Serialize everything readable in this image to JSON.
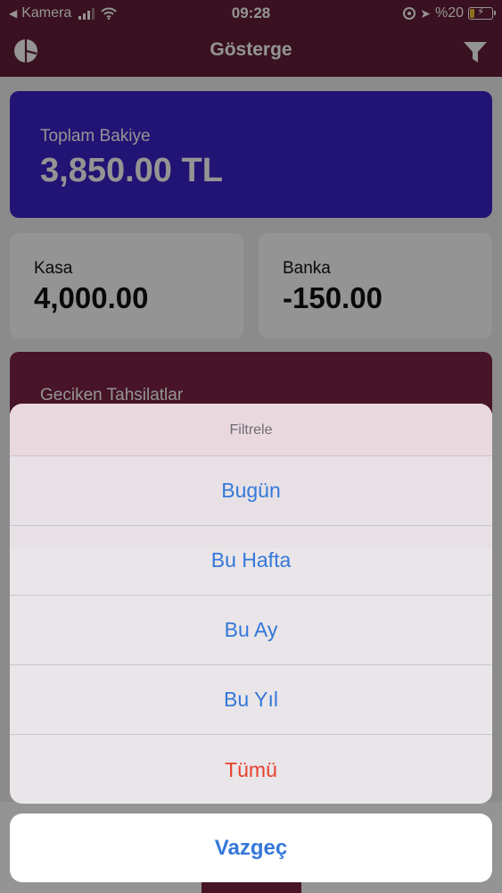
{
  "status_bar": {
    "back_glyph": "◀",
    "carrier": "Kamera",
    "time": "09:28",
    "battery": "%20",
    "battery_level": 0.2,
    "icons": [
      "signal-icon",
      "wifi-icon",
      "orientation-lock-icon",
      "location-icon",
      "battery-icon"
    ]
  },
  "nav": {
    "title": "Gösterge",
    "left_icon": "pie-chart-icon",
    "right_icon": "filter-icon"
  },
  "dashboard": {
    "total": {
      "label": "Toplam Bakiye",
      "value": "3,850.00 TL"
    },
    "kasa": {
      "label": "Kasa",
      "value": "4,000.00"
    },
    "banka": {
      "label": "Banka",
      "value": "-150.00"
    },
    "late": {
      "label": "Geciken Tahsilatlar"
    }
  },
  "action_sheet": {
    "title": "Filtrele",
    "options": [
      {
        "label": "Bugün"
      },
      {
        "label": "Bu Hafta"
      },
      {
        "label": "Bu Ay"
      },
      {
        "label": "Bu Yıl"
      },
      {
        "label": "Tümü"
      }
    ],
    "cancel": "Vazgeç"
  },
  "colors": {
    "nav": "#641e3a",
    "total_card": "#3b23c9",
    "late_card": "#7a2445",
    "action_blue": "#3478d8",
    "destructive_red": "#e8412e"
  }
}
